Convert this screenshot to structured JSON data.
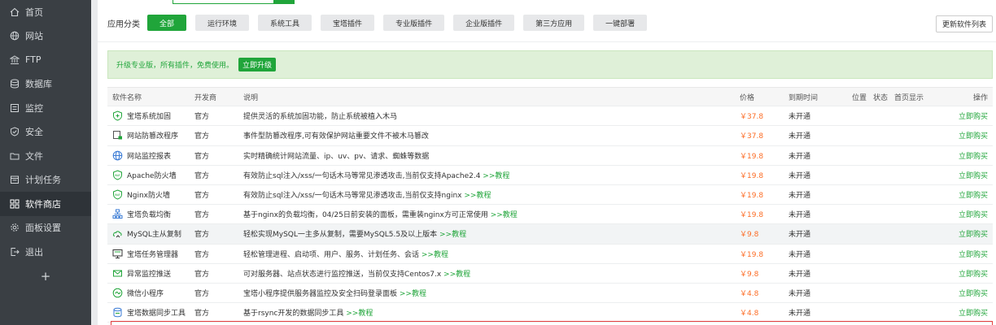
{
  "sidebar": {
    "items": [
      {
        "label": "首页",
        "icon": "home-icon"
      },
      {
        "label": "网站",
        "icon": "globe-icon"
      },
      {
        "label": "FTP",
        "icon": "ftp-icon"
      },
      {
        "label": "数据库",
        "icon": "database-icon"
      },
      {
        "label": "监控",
        "icon": "monitor-icon"
      },
      {
        "label": "安全",
        "icon": "shield-icon"
      },
      {
        "label": "文件",
        "icon": "folder-icon"
      },
      {
        "label": "计划任务",
        "icon": "calendar-icon"
      },
      {
        "label": "软件商店",
        "icon": "grid-icon",
        "active": true
      },
      {
        "label": "面板设置",
        "icon": "gear-icon"
      },
      {
        "label": "退出",
        "icon": "logout-icon"
      }
    ],
    "add_label": "+"
  },
  "categories": {
    "label": "应用分类",
    "items": [
      "全部",
      "运行环境",
      "系统工具",
      "宝塔插件",
      "专业版插件",
      "企业版插件",
      "第三方应用",
      "一键部署"
    ],
    "active_index": 0,
    "update_button": "更新软件列表"
  },
  "upgrade": {
    "text": "升级专业版，所有插件，免费使用。",
    "button": "立即升级"
  },
  "table": {
    "headers": {
      "name": "软件名称",
      "developer": "开发商",
      "description": "说明",
      "price": "价格",
      "expire": "到期时间",
      "position": "位置",
      "status": "状态",
      "homepage": "首页显示",
      "operation": "操作"
    },
    "rows": [
      {
        "name": "宝塔系统加固",
        "icon": "shield-plus-icon",
        "developer": "官方",
        "description": "提供灵活的系统加固功能，防止系统被植入木马",
        "link": "",
        "price": "￥37.8",
        "expire": "未开通",
        "action": "立即购买"
      },
      {
        "name": "网站防篡改程序",
        "icon": "lock-page-icon",
        "developer": "官方",
        "description": "事件型防篡改程序,可有效保护网站重要文件不被木马篡改",
        "link": "",
        "price": "￥37.8",
        "expire": "未开通",
        "action": "立即购买"
      },
      {
        "name": "网站监控报表",
        "icon": "globe-chart-icon",
        "developer": "官方",
        "description": "实时精确统计网站流量、ip、uv、pv、请求、蜘蛛等数据",
        "link": "",
        "price": "￥19.8",
        "expire": "未开通",
        "action": "立即购买"
      },
      {
        "name": "Apache防火墙",
        "icon": "waf-shield-icon",
        "developer": "官方",
        "description": "有效防止sql注入/xss/一句话木马等常见渗透攻击,当前仅支持Apache2.4",
        "link": ">>教程",
        "price": "￥19.8",
        "expire": "未开通",
        "action": "立即购买"
      },
      {
        "name": "Nginx防火墙",
        "icon": "waf-shield-icon",
        "developer": "官方",
        "description": "有效防止sql注入/xss/一句话木马等常见渗透攻击,当前仅支持nginx",
        "link": ">>教程",
        "price": "￥19.8",
        "expire": "未开通",
        "action": "立即购买"
      },
      {
        "name": "宝塔负载均衡",
        "icon": "network-icon",
        "developer": "官方",
        "description": "基于nginx的负载均衡，04/25日前安装的面板，需重装nginx方可正常使用",
        "link": ">>教程",
        "price": "￥19.8",
        "expire": "未开通",
        "action": "立即购买"
      },
      {
        "name": "MySQL主从复制",
        "icon": "sync-cloud-icon",
        "developer": "官方",
        "description": "轻松实现MySQL一主多从复制，需要MySQL5.5及以上版本",
        "link": ">>教程",
        "price": "￥9.8",
        "expire": "未开通",
        "action": "立即购买",
        "hover": true
      },
      {
        "name": "宝塔任务管理器",
        "icon": "monitor-task-icon",
        "developer": "官方",
        "description": "轻松管理进程、启动项、用户、服务、计划任务、会话",
        "link": ">>教程",
        "price": "￥19.8",
        "expire": "未开通",
        "action": "立即购买"
      },
      {
        "name": "异常监控推送",
        "icon": "envelope-icon",
        "developer": "官方",
        "description": "可对服务器、站点状态进行监控推送，当前仅支持Centos7.x",
        "link": ">>教程",
        "price": "￥9.8",
        "expire": "未开通",
        "action": "立即购买"
      },
      {
        "name": "微信小程序",
        "icon": "mini-program-icon",
        "developer": "官方",
        "description": "宝塔小程序提供服务器监控及安全扫码登录面板",
        "link": ">>教程",
        "price": "￥4.8",
        "expire": "未开通",
        "action": "立即购买"
      },
      {
        "name": "宝塔数据同步工具",
        "icon": "data-sync-icon",
        "developer": "官方",
        "description": "基于rsync开发的数据同步工具",
        "link": ">>教程",
        "price": "￥4.8",
        "expire": "未开通",
        "action": "立即购买"
      }
    ]
  },
  "colors": {
    "accent": "#20a53a",
    "price": "#fc6d26",
    "sidebar": "#3a3f44",
    "highlight_border": "#e53e3e"
  }
}
